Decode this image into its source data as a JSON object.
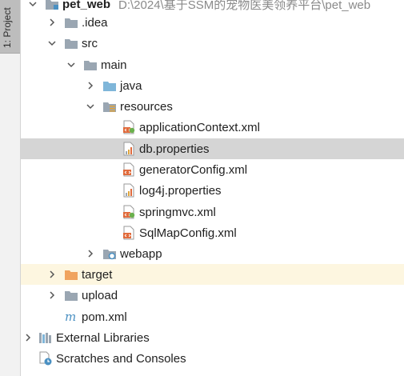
{
  "sidebar": {
    "tab_label": "1: Project"
  },
  "tree": {
    "root": {
      "label": "pet_web",
      "path": "D:\\2024\\基于SSM的宠物医美领养平台\\pet_web"
    },
    "idea": {
      "label": ".idea"
    },
    "src": {
      "label": "src"
    },
    "main": {
      "label": "main"
    },
    "java": {
      "label": "java"
    },
    "resources": {
      "label": "resources"
    },
    "files": [
      {
        "label": "applicationContext.xml"
      },
      {
        "label": "db.properties"
      },
      {
        "label": "generatorConfig.xml"
      },
      {
        "label": "log4j.properties"
      },
      {
        "label": "springmvc.xml"
      },
      {
        "label": "SqlMapConfig.xml"
      }
    ],
    "webapp": {
      "label": "webapp"
    },
    "target": {
      "label": "target"
    },
    "upload": {
      "label": "upload"
    },
    "pom": {
      "label": "pom.xml"
    },
    "external": {
      "label": "External Libraries"
    },
    "scratches": {
      "label": "Scratches and Consoles"
    }
  },
  "colors": {
    "selected_row": "#d5d5d5",
    "excluded_row": "#fdf6e0",
    "folder_gray": "#9aa6b2",
    "folder_blue": "#7fb6d9",
    "folder_orange": "#f0a35e",
    "maven_blue": "#4a90c2"
  }
}
